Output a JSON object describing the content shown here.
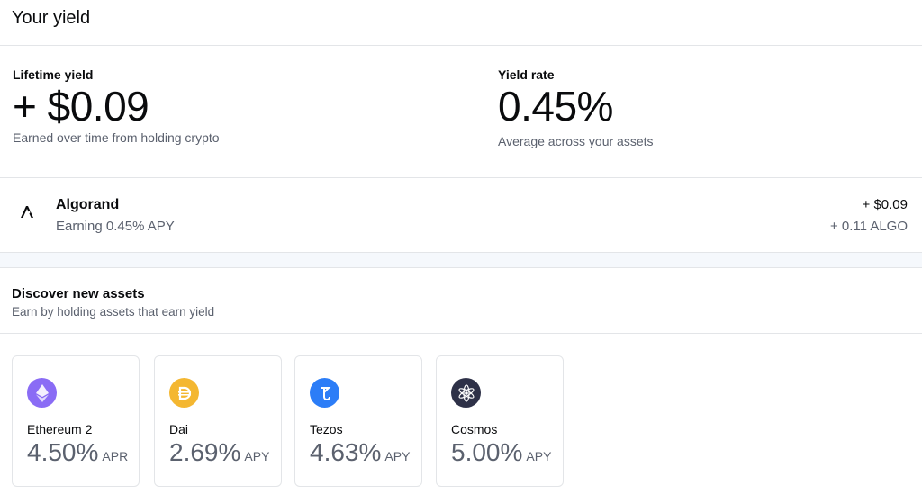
{
  "header": {
    "title": "Your yield"
  },
  "summary": {
    "lifetime": {
      "label": "Lifetime yield",
      "value": "+ $0.09",
      "sub": "Earned over time from holding crypto"
    },
    "rate": {
      "label": "Yield rate",
      "value": "0.45%",
      "sub": "Average across your assets"
    }
  },
  "holding": {
    "name": "Algorand",
    "sub": "Earning 0.45% APY",
    "amount_usd": "+ $0.09",
    "amount_token": "+ 0.11 ALGO",
    "icon": "algorand-icon"
  },
  "discover": {
    "title": "Discover new assets",
    "desc": "Earn by holding assets that earn yield",
    "cards": [
      {
        "name": "Ethereum 2",
        "rate": "4.50%",
        "unit": "APR",
        "icon": "ethereum-icon",
        "color": "#8a6cf5"
      },
      {
        "name": "Dai",
        "rate": "2.69%",
        "unit": "APY",
        "icon": "dai-icon",
        "color": "#f4b731"
      },
      {
        "name": "Tezos",
        "rate": "4.63%",
        "unit": "APY",
        "icon": "tezos-icon",
        "color": "#2c7df7"
      },
      {
        "name": "Cosmos",
        "rate": "5.00%",
        "unit": "APY",
        "icon": "cosmos-icon",
        "color": "#2e3148"
      }
    ]
  }
}
